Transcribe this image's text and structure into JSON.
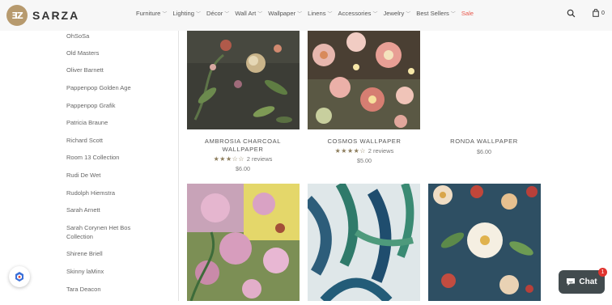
{
  "brand": {
    "name": "SARZA",
    "badge": "ƎZ"
  },
  "nav": [
    {
      "label": "Furniture",
      "chevron": true
    },
    {
      "label": "Lighting",
      "chevron": true
    },
    {
      "label": "Décor",
      "chevron": true
    },
    {
      "label": "Wall Art",
      "chevron": true
    },
    {
      "label": "Wallpaper",
      "chevron": true
    },
    {
      "label": "Linens",
      "chevron": true
    },
    {
      "label": "Accessories",
      "chevron": true
    },
    {
      "label": "Jewelry",
      "chevron": true
    },
    {
      "label": "Best Sellers",
      "chevron": true
    },
    {
      "label": "Sale",
      "chevron": false
    }
  ],
  "header_icons": {
    "search": "search-icon",
    "cart": "bag-icon",
    "cart_count": "0"
  },
  "sidebar": {
    "items": [
      "OhSoSa",
      "Old Masters",
      "Oliver Barnett",
      "Pappenpop Golden Age",
      "Pappenpop Grafik",
      "Patricia Braune",
      "Richard Scott",
      "Room 13 Collection",
      "Rudi De Wet",
      "Rudolph Hiemstra",
      "Sarah Arnett",
      "Sarah Corynen Het Bos Collection",
      "Shirene Briell",
      "Skinny laMinx",
      "Tara Deacon"
    ]
  },
  "products": [
    {
      "title": "AMBROSIA CHARCOAL WALLPAPER",
      "rating": 3.5,
      "reviews": "2 reviews",
      "price": "$6.00"
    },
    {
      "title": "COSMOS WALLPAPER",
      "rating": 4,
      "reviews": "2 reviews",
      "price": "$5.00"
    },
    {
      "title": "RONDA WALLPAPER",
      "rating": null,
      "reviews": "",
      "price": "$6.00"
    }
  ],
  "chat": {
    "label": "Chat",
    "badge": "1"
  },
  "colors": {
    "accent": "#b79a6e",
    "sale": "#e85a4f",
    "chat_bg": "#424b4e",
    "star": "#8b7b5a"
  }
}
